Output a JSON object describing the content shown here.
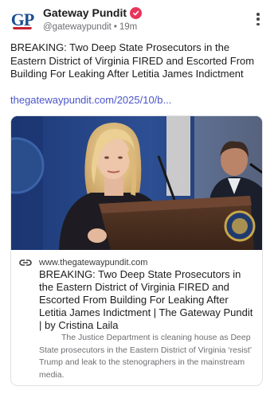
{
  "account": {
    "avatar_text": "GP",
    "display_name": "Gateway Pundit",
    "handle": "@gatewaypundit",
    "separator": "•",
    "time_ago": "19m",
    "avatar_icon": "gateway-pundit-logo",
    "verified_icon": "verified-badge-check",
    "verified_color": "#e8355a"
  },
  "post": {
    "text": "BREAKING: Two Deep State Prosecutors in the Eastern District of Virginia FIRED and Escorted From Building For Leaking After Letitia James Indictment",
    "link_text": "thegatewaypundit.com/2025/10/b...",
    "link_color": "#4a55c9"
  },
  "menu": {
    "icon": "more-vertical-icon"
  },
  "link_card": {
    "image_alt": "Woman with blonde hair speaking at a podium, man in suit in background",
    "link_icon": "chain-link-icon",
    "domain": "www.thegatewaypundit.com",
    "title": "BREAKING: Two Deep State Prosecutors in the Eastern District of Virginia FIRED and Escorted From Building For Leaking After Letitia James Indictment | The Gateway Pundit | by Cristina Laila",
    "description": "The Justice Department is cleaning house as Deep State prosecutors in the Eastern District of Virginia ‘resist’ Trump and leak to the stenographers in the mainstream media."
  }
}
